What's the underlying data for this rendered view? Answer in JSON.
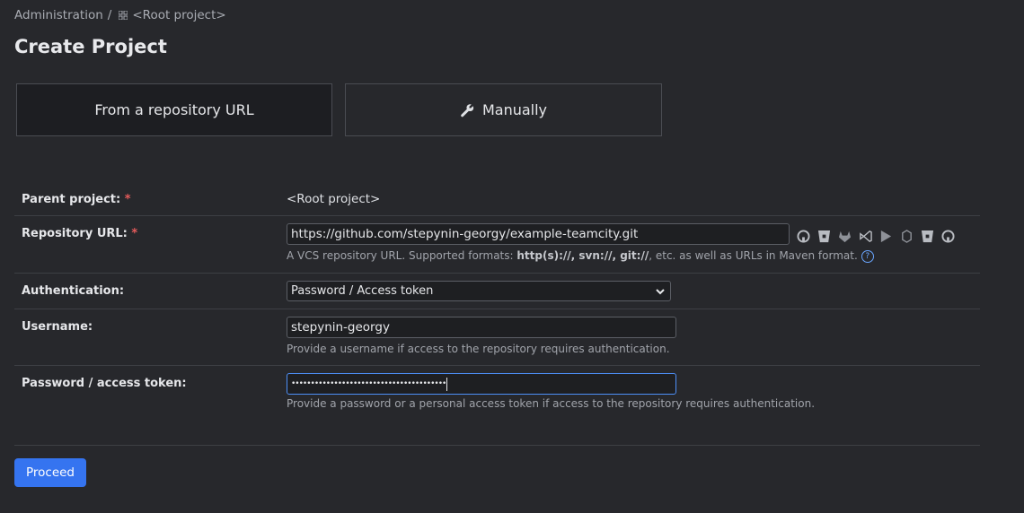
{
  "breadcrumb": {
    "admin": "Administration",
    "separator": "/",
    "project": "<Root project>"
  },
  "page_title": "Create Project",
  "tabs": [
    {
      "label": "From a repository URL",
      "active": true
    },
    {
      "label": "Manually",
      "active": false,
      "icon": "wrench-icon"
    }
  ],
  "form": {
    "parent_project": {
      "label": "Parent project:",
      "required": "*",
      "value": "<Root project>"
    },
    "repository_url": {
      "label": "Repository URL:",
      "required": "*",
      "value": "https://github.com/stepynin-georgy/example-teamcity.git",
      "hint_prefix": "A VCS repository URL. Supported formats:",
      "hint_formats": "http(s)://, svn://, git://",
      "hint_suffix": ", etc. as well as URLs in Maven format.",
      "help": "?",
      "vcs_icons": [
        "github-icon",
        "bitbucket-icon",
        "gitlab-icon",
        "azure-devops-icon",
        "space-icon",
        "perforce-icon",
        "bitbucket-server-icon",
        "github-enterprise-icon"
      ]
    },
    "authentication": {
      "label": "Authentication:",
      "value": "Password / Access token"
    },
    "username": {
      "label": "Username:",
      "value": "stepynin-georgy",
      "hint": "Provide a username if access to the repository requires authentication."
    },
    "password": {
      "label": "Password / access token:",
      "value": "••••••••••••••••••••••••••••••••••••••••",
      "hint": "Provide a password or a personal access token if access to the repository requires authentication."
    }
  },
  "proceed_label": "Proceed",
  "colors": {
    "accent": "#3574f0",
    "background": "#27282c",
    "required": "#e55b5b"
  }
}
